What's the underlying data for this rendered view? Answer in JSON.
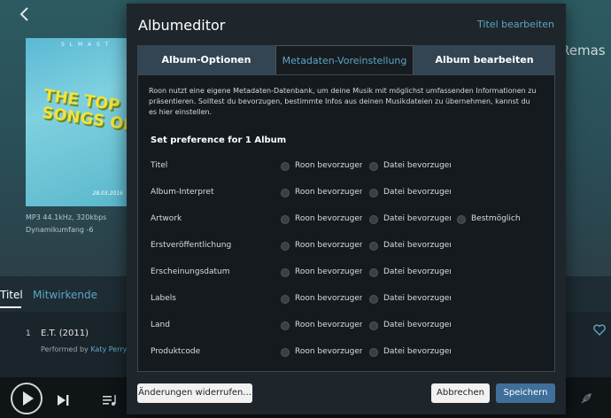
{
  "background": {
    "cover": {
      "top_text": "S L M A S T",
      "line1": "THE TOP",
      "line2": "SONGS OF I",
      "date": "28.03.2016"
    },
    "format": "MP3 44.1kHz, 320kbps",
    "dynamic_range": "Dynamikumfang  -6",
    "title_fragment": "Remas",
    "tabs": {
      "titel": "Titel",
      "mitwirkende": "Mitwirkende"
    },
    "track": {
      "number": "1",
      "title": "E.T. (2011)",
      "performed_by": "Performed by",
      "artist": "Katy Perry"
    }
  },
  "modal": {
    "title": "Albumeditor",
    "edit_titles_link": "Titel bearbeiten",
    "tabs": [
      {
        "label": "Album-Optionen",
        "active": false
      },
      {
        "label": "Metadaten-Voreinstellung",
        "active": true
      },
      {
        "label": "Album bearbeiten",
        "active": false
      }
    ],
    "intro": "Roon nutzt eine eigene Metadaten-Datenbank, um deine Musik mit möglichst umfassenden Informationen zu präsentieren. Solltest du bevorzugen, bestimmte Infos aus deinen Musikdateien zu übernehmen, kannst du es hier einstellen.",
    "set_preference": "Set preference for 1 Album",
    "options": {
      "roon": "Roon bevorzugen",
      "file": "Datei bevorzugen",
      "best": "Bestmöglich"
    },
    "rows": [
      {
        "label": "Titel"
      },
      {
        "label": "Album-Interpret"
      },
      {
        "label": "Artwork"
      },
      {
        "label": "Erstveröffentlichung"
      },
      {
        "label": "Erscheinungsdatum"
      },
      {
        "label": "Labels"
      },
      {
        "label": "Land"
      },
      {
        "label": "Produktcode"
      }
    ],
    "buttons": {
      "revert": "Änderungen widerrufen...",
      "cancel": "Abbrechen",
      "save": "Speichern"
    }
  },
  "colors": {
    "accent": "#5ba6c6",
    "save_button": "#3f6f9a",
    "modal_bg": "#1e262c"
  }
}
